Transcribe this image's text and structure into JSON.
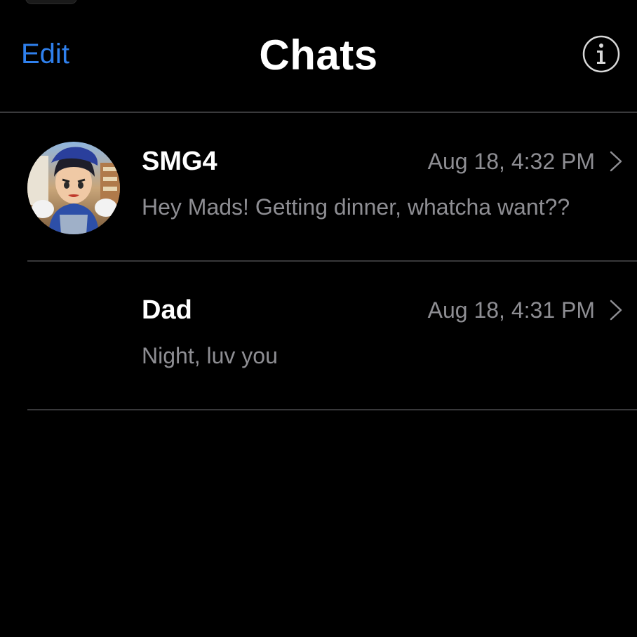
{
  "nav": {
    "edit_label": "Edit",
    "title": "Chats",
    "info_icon": "info-circle-icon"
  },
  "chats": [
    {
      "name": "SMG4",
      "time": "Aug 18, 4:32 PM",
      "preview": "Hey Mads! Getting dinner, whatcha want??",
      "has_avatar": true
    },
    {
      "name": "Dad",
      "time": "Aug 18, 4:31 PM",
      "preview": "Night, luv you",
      "has_avatar": false
    }
  ],
  "colors": {
    "background": "#000000",
    "accent": "#2f80ed",
    "secondary_text": "#8e8e93",
    "divider": "#38383a"
  }
}
